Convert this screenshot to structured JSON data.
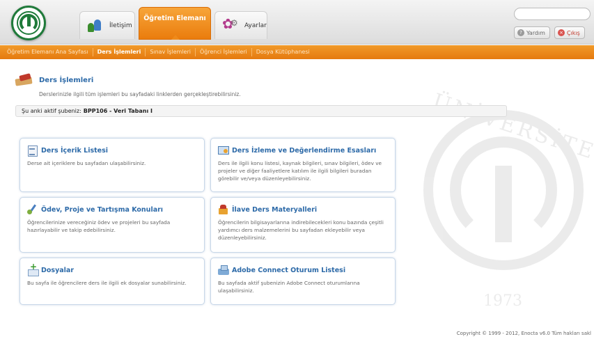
{
  "header": {
    "tabs": [
      {
        "label": "İletişim",
        "icon": "contacts-icon",
        "active": false
      },
      {
        "label": "Öğretim Elemanı",
        "active": true
      },
      {
        "label": "Ayarlar",
        "icon": "settings-icon",
        "active": false
      }
    ],
    "help_label": "Yardım",
    "logout_label": "Çıkış"
  },
  "nav": {
    "items": [
      {
        "label": "Öğretim Elemanı Ana Sayfası",
        "active": false
      },
      {
        "label": "Ders İşlemleri",
        "active": true
      },
      {
        "label": "Sınav İşlemleri",
        "active": false
      },
      {
        "label": "Öğrenci İşlemleri",
        "active": false
      },
      {
        "label": "Dosya Kütüphanesi",
        "active": false
      }
    ]
  },
  "main": {
    "title": "Ders İşlemleri",
    "description": "Derslerinizle ilgili tüm işlemleri bu sayfadaki linklerden gerçekleştirebilirsiniz.",
    "active_section_label": "Şu anki aktif şubeniz:",
    "active_section_value": "BPP106 - Veri Tabanı I",
    "cards": [
      {
        "title": "Ders İçerik Listesi",
        "icon": "content-list-icon",
        "desc": "Derse ait içeriklere bu sayfadan ulaşabilirsiniz."
      },
      {
        "title": "Ders İzleme ve Değerlendirme Esasları",
        "icon": "monitor-icon",
        "desc": "Ders ile ilgili konu listesi, kaynak bilgileri, sınav bilgileri, ödev ve projeler ve diğer faaliyetlere katılım ile ilgili bilgileri buradan görebilir ve/veya düzenleyebilirsiniz."
      },
      {
        "title": "Ödev, Proje ve Tartışma Konuları",
        "icon": "assignment-icon",
        "desc": "Öğrencilerinize vereceğiniz ödev ve projeleri bu sayfada hazırlayabilir ve takip edebilirsiniz."
      },
      {
        "title": "İlave Ders Materyalleri",
        "icon": "materials-icon",
        "desc": "Öğrencilerin bilgisayarlarına indirebilecekleri konu bazında çeşitli yardımcı ders malzemelerini bu sayfadan ekleyebilir veya düzenleyebilirsiniz."
      },
      {
        "title": "Dosyalar",
        "icon": "add-file-icon",
        "desc": "Bu sayfa ile öğrencilere ders ile ilgili ek dosyalar sunabilirsiniz."
      },
      {
        "title": "Adobe Connect Oturum Listesi",
        "icon": "adobe-connect-icon",
        "desc": "Bu sayfada aktif şubenizin Adobe Connect oturumlarına ulaşabilirsiniz."
      }
    ]
  },
  "watermark": {
    "text": "ÜNİVERSİTESİ",
    "year": "1973"
  },
  "footer": {
    "copyright": "Copyright © 1999 - 2012, Enocta v6.0 Tüm hakları sakl"
  },
  "colors": {
    "accent": "#ef8a1a",
    "link": "#2d6aa8",
    "logo_green": "#1f7a3a",
    "logout_red": "#c0392b"
  }
}
